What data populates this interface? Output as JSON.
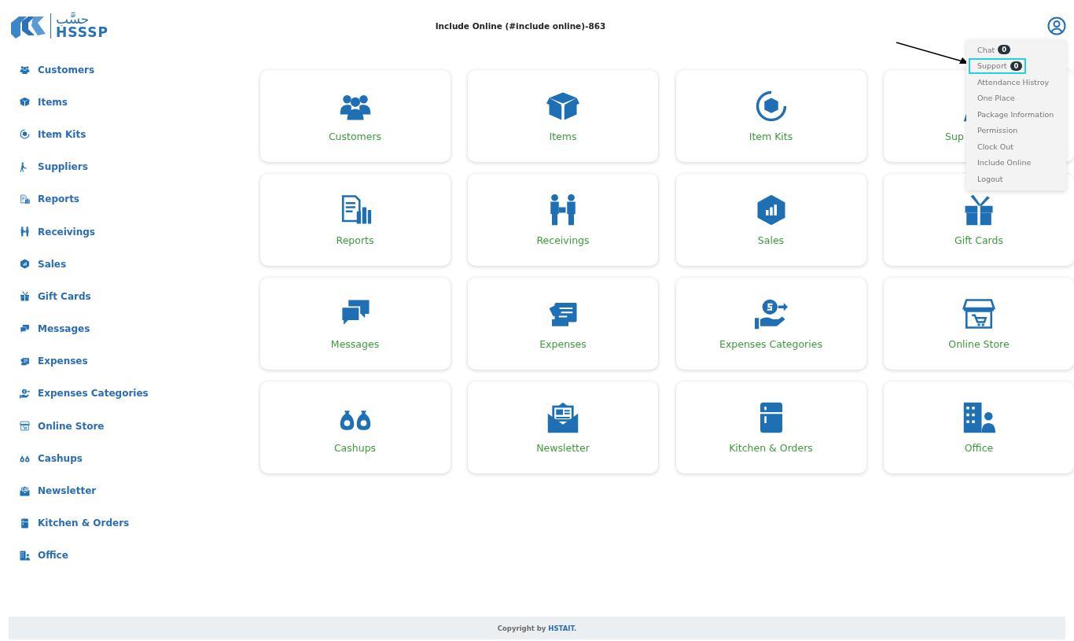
{
  "header": {
    "logo_arabic": "حسَّب",
    "logo_text": "HSSSP",
    "title": "Include Online (#include online)-863"
  },
  "sidebar": {
    "items": [
      {
        "label": "Customers"
      },
      {
        "label": "Items"
      },
      {
        "label": "Item Kits"
      },
      {
        "label": "Suppliers"
      },
      {
        "label": "Reports"
      },
      {
        "label": "Receivings"
      },
      {
        "label": "Sales"
      },
      {
        "label": "Gift Cards"
      },
      {
        "label": "Messages"
      },
      {
        "label": "Expenses"
      },
      {
        "label": "Expenses Categories"
      },
      {
        "label": "Online Store"
      },
      {
        "label": "Cashups"
      },
      {
        "label": "Newsletter"
      },
      {
        "label": "Kitchen & Orders"
      },
      {
        "label": "Office"
      }
    ]
  },
  "cards": [
    {
      "label": "Customers"
    },
    {
      "label": "Items"
    },
    {
      "label": "Item Kits"
    },
    {
      "label": "Sup"
    },
    {
      "label": "Reports"
    },
    {
      "label": "Receivings"
    },
    {
      "label": "Sales"
    },
    {
      "label": "Gift Cards"
    },
    {
      "label": "Messages"
    },
    {
      "label": "Expenses"
    },
    {
      "label": "Expenses Categories"
    },
    {
      "label": "Online Store"
    },
    {
      "label": "Cashups"
    },
    {
      "label": "Newsletter"
    },
    {
      "label": "Kitchen & Orders"
    },
    {
      "label": "Office"
    }
  ],
  "user_menu": {
    "items": [
      {
        "label": "Chat",
        "badge": "0",
        "highlighted": false
      },
      {
        "label": "Support",
        "badge": "0",
        "highlighted": true
      },
      {
        "label": "Attendance Histroy",
        "highlighted": false
      },
      {
        "label": "One Place",
        "highlighted": false
      },
      {
        "label": "Package Information",
        "highlighted": false
      },
      {
        "label": "Permission",
        "highlighted": false
      },
      {
        "label": "Clock Out",
        "highlighted": false
      },
      {
        "label": "Include Online",
        "highlighted": false
      },
      {
        "label": "Logout",
        "highlighted": false
      }
    ]
  },
  "footer": {
    "text": "Copyright by",
    "link": "HSTAIT",
    "end": "."
  }
}
